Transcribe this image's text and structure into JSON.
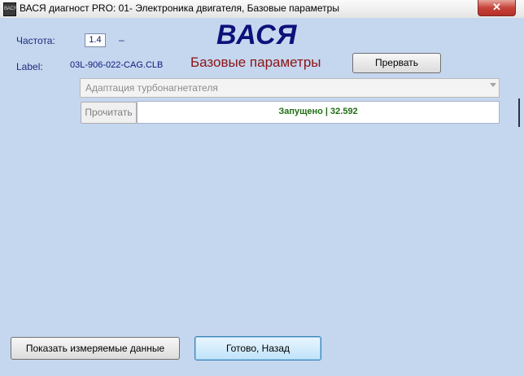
{
  "window": {
    "icon_text": "ВАСЯ",
    "title": "ВАСЯ диагност PRO: 01- Электроника двигателя,  Базовые параметры",
    "close_label": "✕"
  },
  "header": {
    "freq_label": "Частота:",
    "freq_value": "1.4",
    "freq_dash": "–",
    "logo": "ВАСЯ",
    "mode_title": "Базовые параметры",
    "label_caption": "Label:",
    "label_value": "03L-906-022-CAG.CLB",
    "stop_button": "Прервать"
  },
  "function": {
    "selected": "Адаптация турбонагнетателя",
    "read_button": "Прочитать",
    "status": "Запущено | 32.592"
  },
  "footer": {
    "show_data_button": "Показать измеряемые данные",
    "done_button": "Готово, Назад"
  }
}
